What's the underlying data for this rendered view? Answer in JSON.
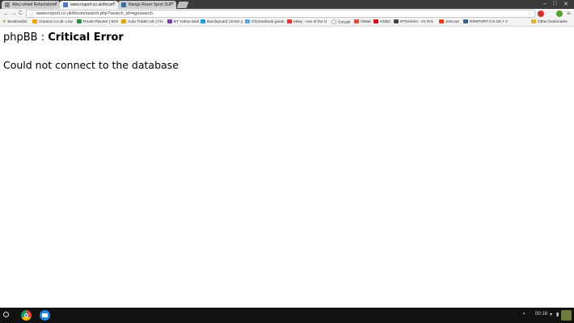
{
  "tabs": [
    {
      "label": "Alloy wheel Refurbishme"
    },
    {
      "label": "www.rrsport.co.uk/forum"
    },
    {
      "label": "Range Rover Sport SUP"
    }
  ],
  "window": {
    "min": "–",
    "max": "□",
    "close": "✕"
  },
  "toolbar": {
    "url": "www.rrsport.co.uk/forum/search.php?search_id=egosearch",
    "back": "←",
    "forward": "→",
    "reload": "C",
    "menu": "≡"
  },
  "bookmarks": [
    {
      "label": "Bookmarks",
      "color": "#e7b52a"
    },
    {
      "label": "Amazon.co.uk: Low",
      "color": "#f0a000"
    },
    {
      "label": "Route Planner | Driv",
      "color": "#2c8a3e"
    },
    {
      "label": "Auto Trader UK | Fin",
      "color": "#d9a400"
    },
    {
      "label": "BT Yahoo Mail",
      "color": "#7e3ca7"
    },
    {
      "label": "Barclaycard | Enter y",
      "color": "#1c9ad6"
    },
    {
      "label": "Chromebook guide",
      "color": "#5da4e3"
    },
    {
      "label": "eBay - one of the U",
      "color": "#e53238"
    },
    {
      "label": "Google",
      "color": "#ffffff"
    },
    {
      "label": "GMail",
      "color": "#dd4b39"
    },
    {
      "label": "HSBC",
      "color": "#db0011"
    },
    {
      "label": "IPTorrents - #1 Priv",
      "color": "#444444"
    },
    {
      "label": "Just eat",
      "color": "#e2401c"
    },
    {
      "label": "RRSPORT.CO.UK • V",
      "color": "#3b5f8a"
    },
    {
      "label": "Other bookmarks",
      "color": "#e7b52a"
    }
  ],
  "page": {
    "title_prefix": "phpBB : ",
    "title_bold": "Critical Error",
    "message": "Could not connect to the database"
  },
  "shelf": {
    "time": "00:18",
    "wifi": "▾",
    "battery": "▮",
    "notif": "▪"
  }
}
